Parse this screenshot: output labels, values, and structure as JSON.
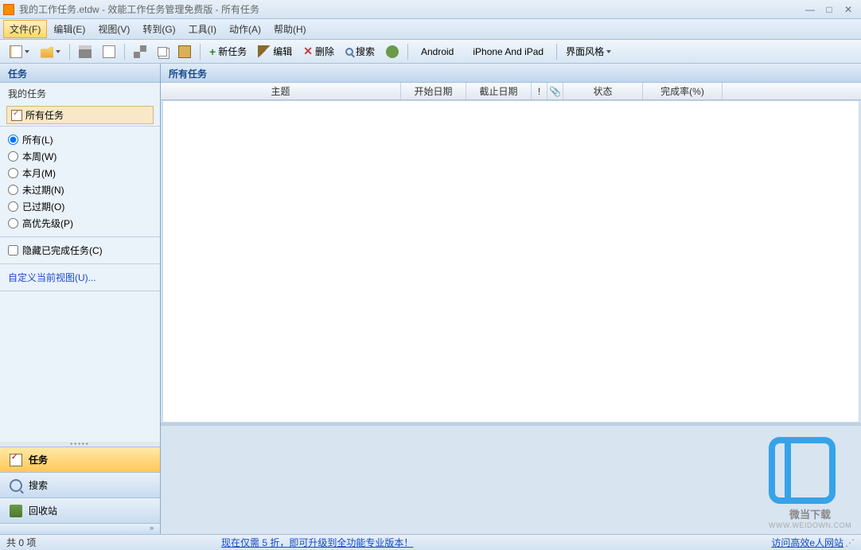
{
  "title": "我的工作任务.etdw - 效能工作任务管理免费版 - 所有任务",
  "menu": {
    "file": "文件(F)",
    "edit": "编辑(E)",
    "view": "视图(V)",
    "goto": "转到(G)",
    "tools": "工具(I)",
    "action": "动作(A)",
    "help": "帮助(H)"
  },
  "toolbar": {
    "new_task": "新任务",
    "edit": "编辑",
    "delete": "删除",
    "search": "搜索",
    "android": "Android",
    "iphone": "iPhone And iPad",
    "ui_style": "界面风格"
  },
  "sidebar": {
    "header": "任务",
    "my_tasks": "我的任务",
    "all_tasks": "所有任务",
    "filters": {
      "all": "所有(L)",
      "this_week": "本周(W)",
      "this_month": "本月(M)",
      "not_overdue": "未过期(N)",
      "overdue": "已过期(O)",
      "high_priority": "高优先级(P)"
    },
    "hide_completed": "隐藏已完成任务(C)",
    "customize_view": "自定义当前视图(U)...",
    "nav": {
      "tasks": "任务",
      "search": "搜索",
      "recycle": "回收站"
    }
  },
  "content": {
    "header": "所有任务",
    "columns": {
      "subject": "主题",
      "start_date": "开始日期",
      "due_date": "截止日期",
      "priority": "!",
      "attachment": "📎",
      "status": "状态",
      "completion": "完成率(%)"
    }
  },
  "watermark": {
    "text": "微当下载",
    "url": "WWW.WEIDOWN.COM"
  },
  "statusbar": {
    "count": "共 0 项",
    "promo": "现在仅需 5 折，即可升级到全功能专业版本！",
    "website": "访问高效e人网站"
  }
}
